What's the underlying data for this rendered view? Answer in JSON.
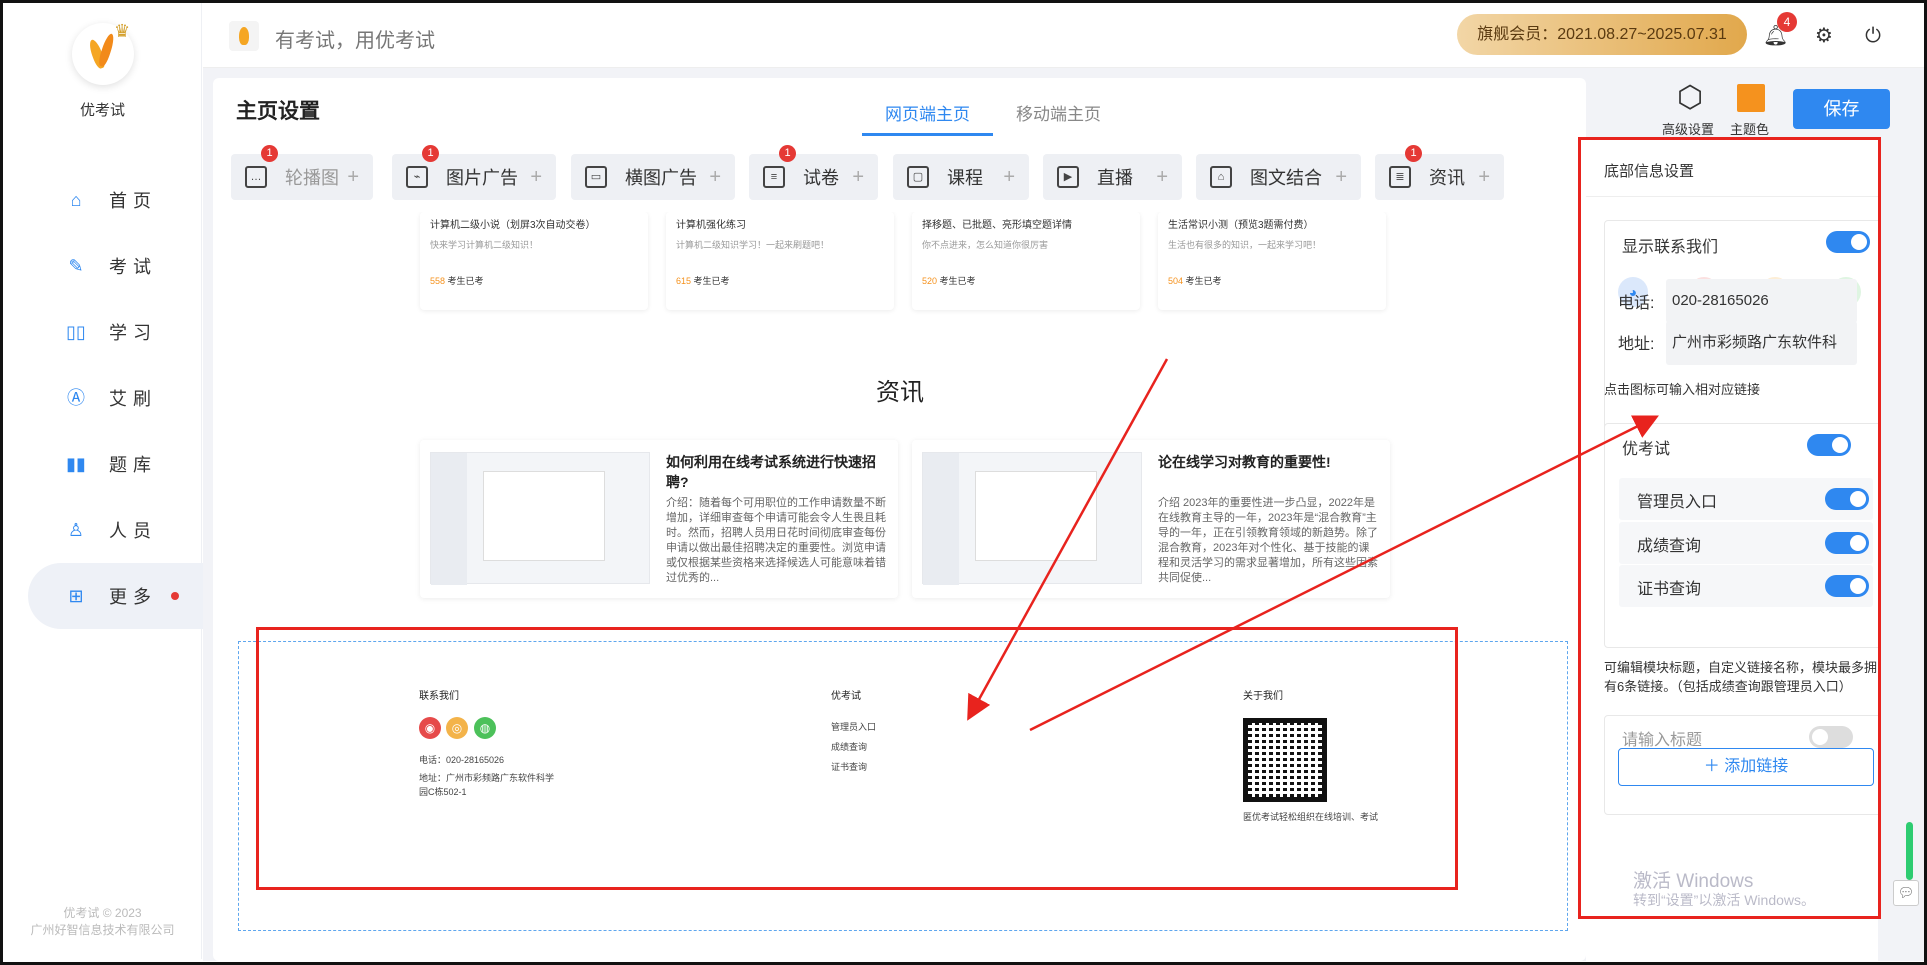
{
  "sidebar": {
    "brand": "优考试",
    "items": [
      {
        "label": "首页",
        "icon": "home-icon"
      },
      {
        "label": "考试",
        "icon": "pencil-icon"
      },
      {
        "label": "学习",
        "icon": "book-icon"
      },
      {
        "label": "艾刷",
        "icon": "brush-icon"
      },
      {
        "label": "题库",
        "icon": "bar-chart-icon"
      },
      {
        "label": "人员",
        "icon": "user-icon"
      },
      {
        "label": "更多",
        "icon": "grid-icon"
      }
    ],
    "copyright1": "优考试 © 2023",
    "copyright2": "广州好智信息技术有限公司"
  },
  "topbar": {
    "slogan": "有考试，用优考试",
    "membership": "旗舰会员：2021.08.27~2025.07.31",
    "notification_count": "4"
  },
  "page": {
    "title": "主页设置",
    "tabs": [
      "网页端主页",
      "移动端主页"
    ],
    "advanced_label": "高级设置",
    "theme_label": "主题色",
    "save_label": "保存",
    "theme_color": "#f5921e"
  },
  "modules": [
    {
      "label": "轮播图",
      "badge": "1"
    },
    {
      "label": "图片广告",
      "badge": "1"
    },
    {
      "label": "横图广告",
      "badge": ""
    },
    {
      "label": "试卷",
      "badge": "1"
    },
    {
      "label": "课程",
      "badge": ""
    },
    {
      "label": "直播",
      "badge": ""
    },
    {
      "label": "图文结合",
      "badge": ""
    },
    {
      "label": "资讯",
      "badge": "1"
    }
  ],
  "preview": {
    "cards": [
      {
        "title": "计算机二级小说（划屏3次自动交卷）",
        "desc": "快来学习计算机二级知识！",
        "count": "558",
        "suffix": "考生已考"
      },
      {
        "title": "计算机强化练习",
        "desc": "计算机二级知识学习！一起来刷题吧！",
        "count": "615",
        "suffix": "考生已考"
      },
      {
        "title": "择移题、已批题、亮形填空题详情",
        "desc": "你不点进来，怎么知道你很厉害",
        "count": "520",
        "suffix": "考生已考"
      },
      {
        "title": "生活常识小测（预览3题需付费）",
        "desc": "生活也有很多的知识，一起来学习吧！",
        "count": "504",
        "suffix": "考生已考"
      }
    ],
    "news_title": "资讯",
    "news": [
      {
        "title": "如何利用在线考试系统进行快速招聘?",
        "desc": "介绍：随着每个可用职位的工作申请数量不断增加，详细审查每个申请可能会令人生畏且耗时。然而，招聘人员用日花时间彻底审查每份申请以做出最佳招聘决定的重要性。浏览申请或仅根据某些资格来选择候选人可能意味着错过优秀的..."
      },
      {
        "title": "论在线学习对教育的重要性!",
        "desc": "介绍 2023年的重要性进一步凸显，2022年是在线教育主导的一年，2023年是“混合教育”主导的一年，正在引领教育领域的新趋势。除了混合教育，2023年对个性化、基于技能的课程和灵活学习的需求显著增加，所有这些因素共同促使..."
      }
    ],
    "footer": {
      "contact_title": "联系我们",
      "phone": "电话：020-28165026",
      "address": "地址：广州市彩频路广东软件科学园C栋502-1",
      "links_title": "优考试",
      "links": [
        "管理员入口",
        "成绩查询",
        "证书查询"
      ],
      "about_title": "关于我们",
      "about_desc": "匿优考试轻松组织在线培训、考试"
    }
  },
  "settings": {
    "header": "底部信息设置",
    "show_contact": "显示联系我们",
    "phone_label": "电话:",
    "phone_value": "020-28165026",
    "address_label": "地址:",
    "address_value": "广州市彩频路广东软件科",
    "hint": "点击图标可输入相对应链接",
    "links_module": "优考试",
    "links": [
      "管理员入口",
      "成绩查询",
      "证书查询"
    ],
    "add_link": "添加链接",
    "note": "可编辑模块标题，自定义链接名称，模块最多拥有6条链接。（包括成绩查询跟管理员入口）",
    "next_placeholder": "请输入标题"
  },
  "watermark": {
    "line1": "激活 Windows",
    "line2": "转到“设置”以激活 Windows。"
  }
}
